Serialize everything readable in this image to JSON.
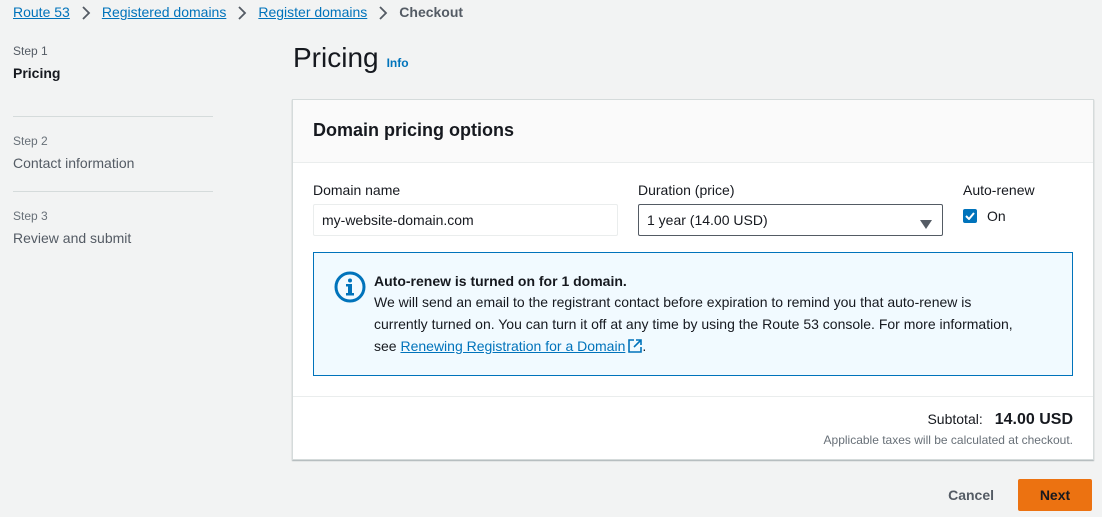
{
  "breadcrumb": {
    "items": [
      "Route 53",
      "Registered domains",
      "Register domains"
    ],
    "current": "Checkout"
  },
  "steps": [
    {
      "num": "Step 1",
      "title": "Pricing"
    },
    {
      "num": "Step 2",
      "title": "Contact information"
    },
    {
      "num": "Step 3",
      "title": "Review and submit"
    }
  ],
  "header": {
    "title": "Pricing",
    "info": "Info"
  },
  "panel": {
    "title": "Domain pricing options",
    "domain": {
      "label": "Domain name",
      "value": "my-website-domain.com"
    },
    "duration": {
      "label": "Duration (price)",
      "value": "1 year (14.00 USD)"
    },
    "autorenew": {
      "label": "Auto-renew",
      "checkbox_label": "On",
      "checked": true
    }
  },
  "alert": {
    "title": "Auto-renew is turned on for 1 domain.",
    "body_line1": "We will send an email to the registrant contact before expiration to remind you that auto-renew is",
    "body_line2": "currently turned on. You can turn it off at any time by using the Route 53 console. For more information,",
    "body_prefix": "see",
    "link": "Renewing Registration for a Domain",
    "body_suffix": "."
  },
  "footer": {
    "subtotal_label": "Subtotal:",
    "subtotal_value": "14.00 USD",
    "tax_note": "Applicable taxes will be calculated at checkout."
  },
  "actions": {
    "cancel": "Cancel",
    "next": "Next"
  },
  "colors": {
    "link": "#0073bb",
    "primary": "#ec7211",
    "alert_bg": "#f1faff"
  }
}
